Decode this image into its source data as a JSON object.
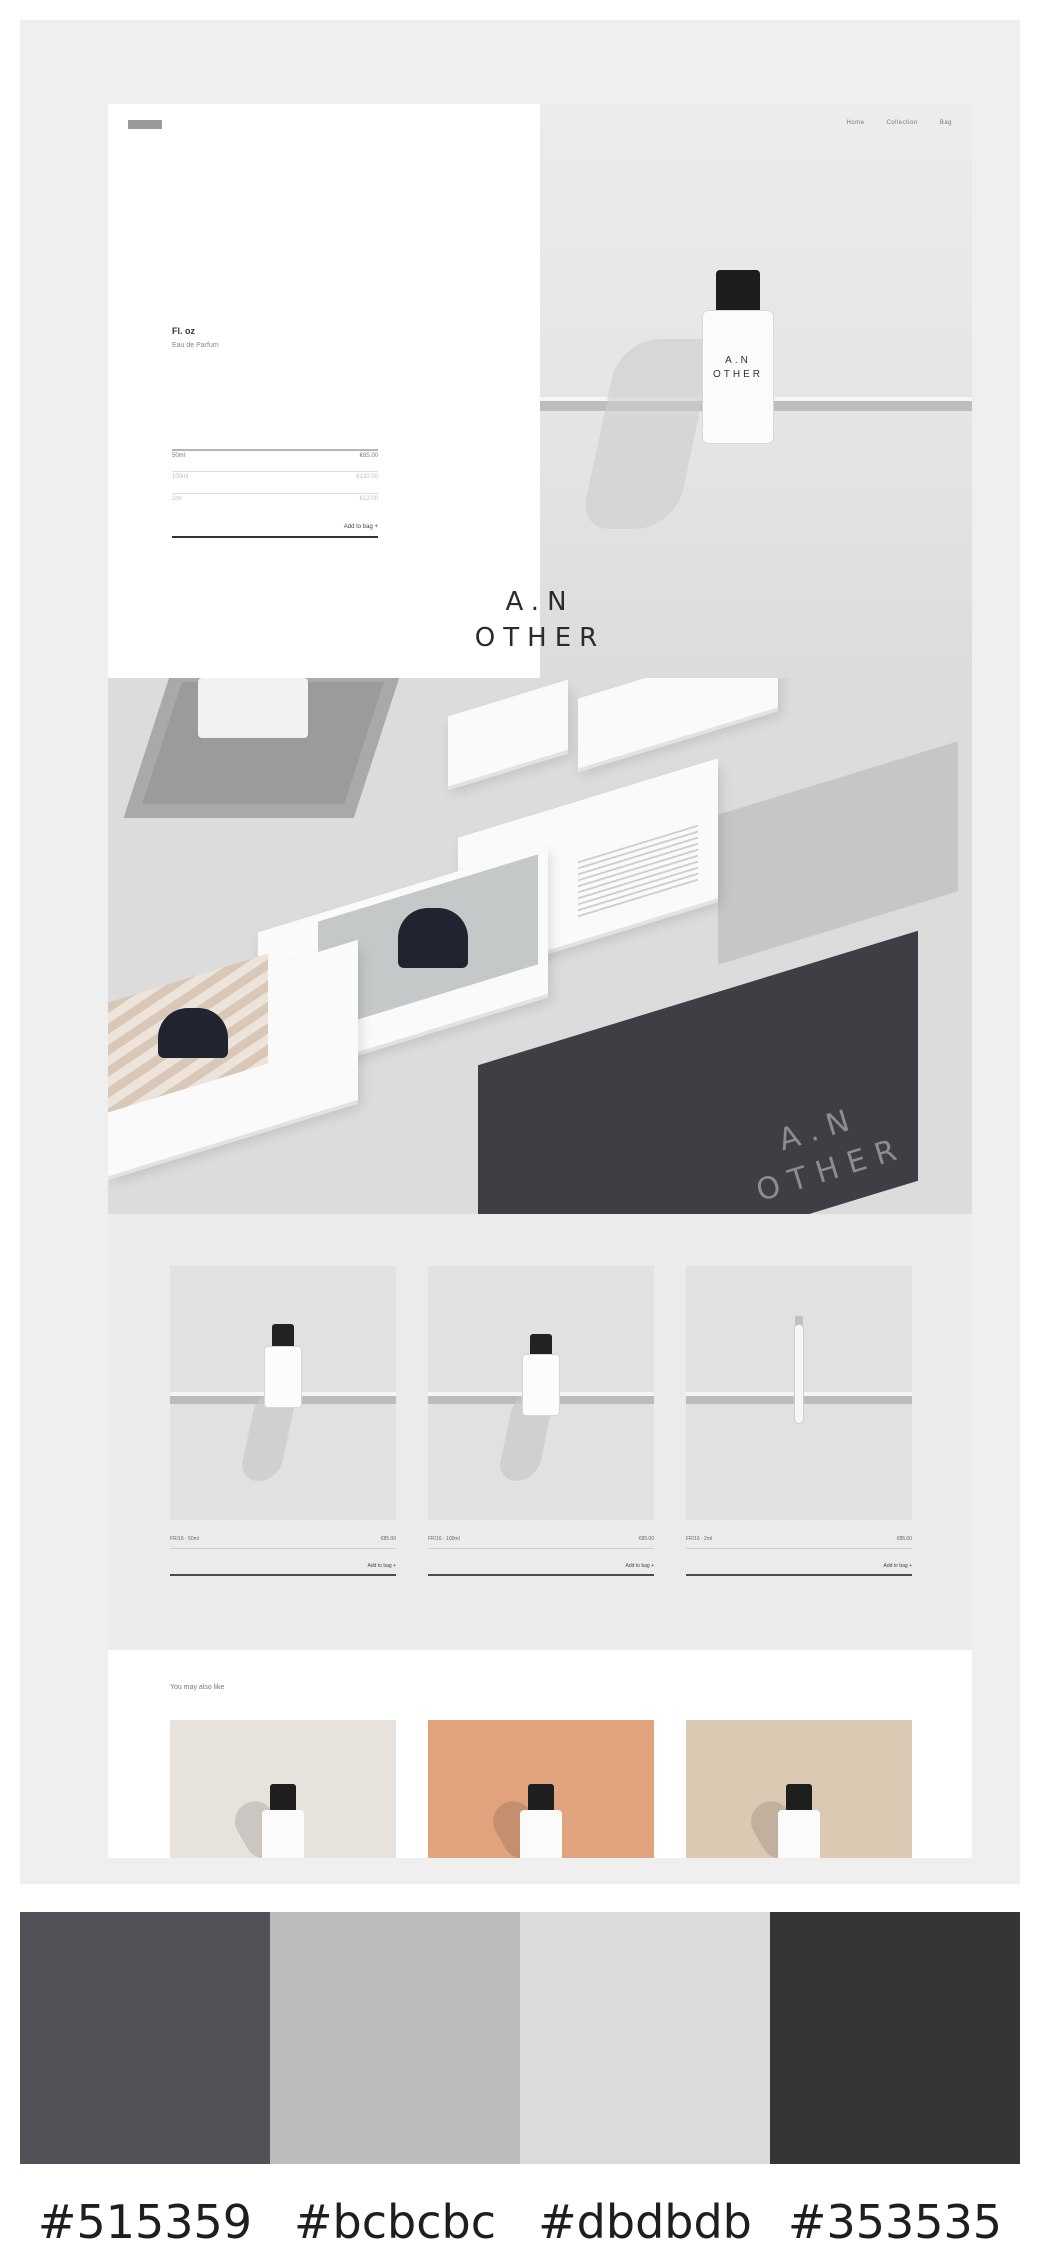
{
  "hero": {
    "nav": [
      "Home",
      "Collection",
      "Bag"
    ],
    "product_title": "Fl. oz",
    "product_subtitle": "Eau de Parfum",
    "options": [
      {
        "label": "50ml",
        "price": "€85.00"
      },
      {
        "label": "100ml",
        "price": "€120.00"
      },
      {
        "label": "2ml",
        "price": "€12.00"
      }
    ],
    "add_to_bag": "Add to bag +",
    "bottle_label": [
      "A.N",
      "OTHER"
    ],
    "brand_line1": "A.N",
    "brand_line2": "OTHER"
  },
  "banner": {
    "folder_line1": "A.N",
    "folder_line2": "OTHER",
    "card_brand": "A.N OTHER"
  },
  "products": [
    {
      "name": "FR/16 · 50ml",
      "price": "€85.00",
      "add": "Add to bag +",
      "kind": "bottle"
    },
    {
      "name": "FR/16 · 100ml",
      "price": "€85.00",
      "add": "Add to bag +",
      "kind": "bottle"
    },
    {
      "name": "FR/16 · 2ml",
      "price": "€85.00",
      "add": "Add to bag +",
      "kind": "vial"
    }
  ],
  "recommend": {
    "title": "You may also like",
    "items": [
      {
        "bg": "#e7e2dc"
      },
      {
        "bg": "#e1a37e"
      },
      {
        "bg": "#dbc9b3"
      }
    ]
  },
  "palette": [
    {
      "hex": "#515359",
      "label": "#515359"
    },
    {
      "hex": "#bcbcbc",
      "label": "#bcbcbc"
    },
    {
      "hex": "#dbdbdb",
      "label": "#dbdbdb"
    },
    {
      "hex": "#353535",
      "label": "#353535"
    }
  ]
}
